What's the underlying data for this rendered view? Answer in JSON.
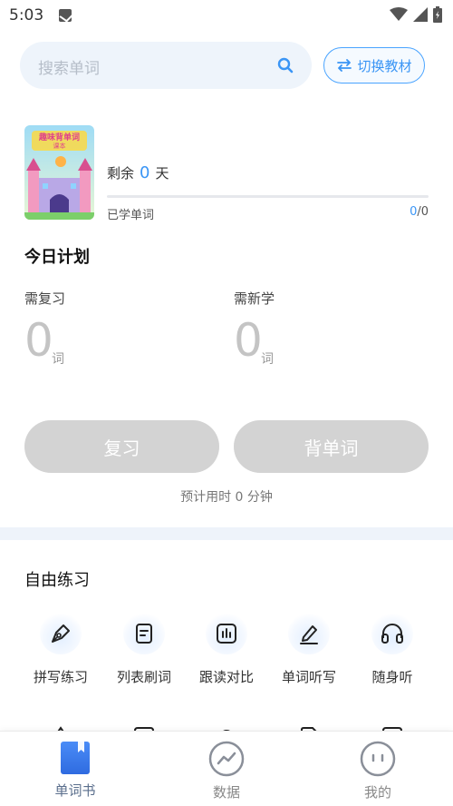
{
  "status_bar": {
    "time": "5:03"
  },
  "search": {
    "placeholder": "搜索单词"
  },
  "switch_book": {
    "label": "切换教材"
  },
  "book": {
    "cover_title": "趣味背单词",
    "cover_subtitle": "课本",
    "remaining_prefix": "剩余",
    "remaining_days": "0",
    "remaining_suffix": "天",
    "learned_label": "已学单词",
    "learned_current": "0",
    "learned_total": "/0",
    "progress": 0
  },
  "plan": {
    "title": "今日计划",
    "review_label": "需复习",
    "review_count": "0",
    "new_label": "需新学",
    "new_count": "0",
    "unit": "词",
    "review_button": "复习",
    "learn_button": "背单词",
    "estimate": "预计用时 0 分钟"
  },
  "free_practice": {
    "title": "自由练习",
    "items": [
      {
        "label": "拼写练习",
        "icon": "pen-nib-icon"
      },
      {
        "label": "列表刷词",
        "icon": "list-doc-icon"
      },
      {
        "label": "跟读对比",
        "icon": "waveform-icon"
      },
      {
        "label": "单词听写",
        "icon": "pencil-line-icon"
      },
      {
        "label": "随身听",
        "icon": "headphones-icon"
      }
    ]
  },
  "bottom_nav": {
    "items": [
      {
        "label": "单词书",
        "icon": "book-icon",
        "active": true
      },
      {
        "label": "数据",
        "icon": "chart-icon",
        "active": false
      },
      {
        "label": "我的",
        "icon": "profile-icon",
        "active": false
      }
    ]
  },
  "colors": {
    "accent": "#3a95f5",
    "disabled_button": "#d3d3d3",
    "search_bg": "#eef4fb"
  }
}
